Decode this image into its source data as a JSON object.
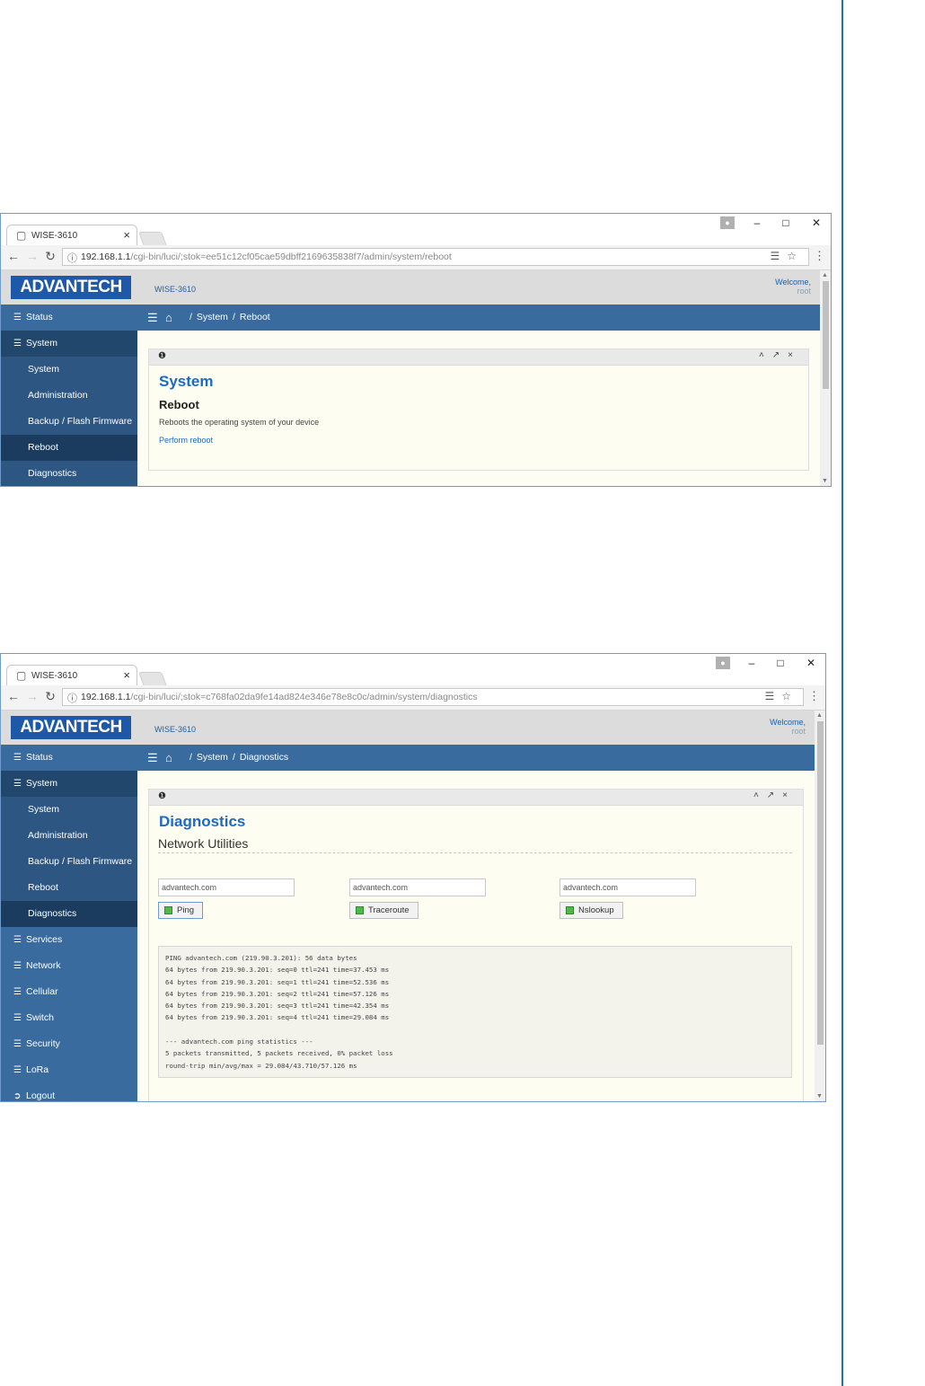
{
  "screenshots": [
    {
      "tab_title": "WISE-3610",
      "url_host": "192.168.1.1",
      "url_path": "/cgi-bin/luci/;stok=ee51c12cf05cae59dbff2169635838f7/admin/system/reboot",
      "logo": "ADVANTECH",
      "device": "WISE-3610",
      "welcome": "Welcome,",
      "user": "root",
      "sidebar": [
        "Status",
        "System",
        "System",
        "Administration",
        "Backup / Flash Firmware",
        "Reboot",
        "Diagnostics"
      ],
      "breadcrumb": [
        "System",
        "Reboot"
      ],
      "page_title": "System",
      "page_subtitle": "Reboot",
      "description": "Reboots the operating system of your device",
      "action_link": "Perform reboot"
    },
    {
      "tab_title": "WISE-3610",
      "url_host": "192.168.1.1",
      "url_path": "/cgi-bin/luci/;stok=c768fa02da9fe14ad824e346e78e8c0c/admin/system/diagnostics",
      "logo": "ADVANTECH",
      "device": "WISE-3610",
      "welcome": "Welcome,",
      "user": "root",
      "sidebar": [
        "Status",
        "System",
        "System",
        "Administration",
        "Backup / Flash Firmware",
        "Reboot",
        "Diagnostics",
        "Services",
        "Network",
        "Cellular",
        "Switch",
        "Security",
        "LoRa",
        "Logout"
      ],
      "breadcrumb": [
        "System",
        "Diagnostics"
      ],
      "page_title": "Diagnostics",
      "section_title": "Network Utilities",
      "inputs": [
        "advantech.com",
        "advantech.com",
        "advantech.com"
      ],
      "buttons": [
        "Ping",
        "Traceroute",
        "Nslookup"
      ],
      "output": [
        "PING advantech.com (219.90.3.201): 56 data bytes",
        "64 bytes from 219.90.3.201: seq=0 ttl=241 time=37.453 ms",
        "64 bytes from 219.90.3.201: seq=1 ttl=241 time=52.536 ms",
        "64 bytes from 219.90.3.201: seq=2 ttl=241 time=57.126 ms",
        "64 bytes from 219.90.3.201: seq=3 ttl=241 time=42.354 ms",
        "64 bytes from 219.90.3.201: seq=4 ttl=241 time=29.084 ms",
        "",
        "--- advantech.com ping statistics ---",
        "5 packets transmitted, 5 packets received, 0% packet loss",
        "round-trip min/avg/max = 29.084/43.710/57.126 ms"
      ]
    }
  ],
  "icons": {
    "tab": "page-icon",
    "back": "back-arrow-icon",
    "forward": "forward-arrow-icon",
    "reload": "reload-icon",
    "info": "info-icon",
    "translate": "translate-icon",
    "star": "star-icon",
    "menu": "hamburger-icon",
    "home": "home-icon"
  },
  "colors": {
    "brand_blue": "#1d59a8",
    "sidebar": "#3a6b9e",
    "sidebar_active": "#1b3b5f",
    "title_blue": "#1d6ac4",
    "panel_bg": "#fdfdf1"
  }
}
